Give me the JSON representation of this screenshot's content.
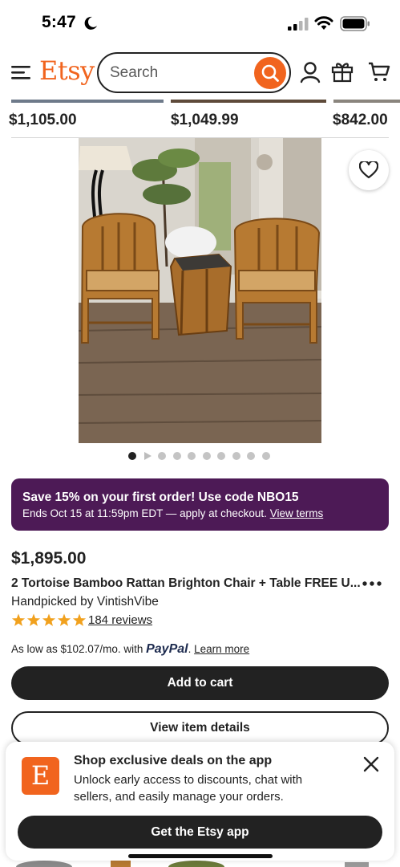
{
  "status_bar": {
    "time": "5:47"
  },
  "header": {
    "logo": "Etsy",
    "search_placeholder": "Search",
    "icons": [
      "menu-icon",
      "search-icon",
      "user-icon",
      "gift-icon",
      "cart-icon"
    ]
  },
  "previous_row": {
    "prices": [
      "$1,105.00",
      "$1,049.99",
      "$842.00"
    ]
  },
  "carousel": {
    "total_dots": 10,
    "active_index": 0,
    "video_index": 1
  },
  "promo": {
    "title": "Save 15% on your first order! Use code NBO15",
    "subtitle": "Ends Oct 15 at 11:59pm EDT — apply at checkout.",
    "link": "View terms",
    "color": "#4D1A56"
  },
  "product": {
    "price": "$1,895.00",
    "title": "2 Tortoise Bamboo Rattan Brighton Chair + Table FREE U...",
    "shop_line": "Handpicked by VintishVibe",
    "rating": 5,
    "reviews": "184 reviews",
    "paypal": {
      "prefix": "As low as $102.07/mo. with",
      "brand": "PayPal",
      "suffix": ".",
      "link": "Learn more"
    }
  },
  "buttons": {
    "add_to_cart": "Add to cart",
    "view_details": "View item details"
  },
  "app_sheet": {
    "title": "Shop exclusive deals on the app",
    "description": "Unlock early access to discounts, chat with sellers, and easily manage your orders.",
    "cta": "Get the Etsy app",
    "icon_letter": "E"
  },
  "colors": {
    "brand": "#F1641E",
    "promo": "#4D1A56",
    "button": "#222222",
    "star": "#F1A11E"
  }
}
